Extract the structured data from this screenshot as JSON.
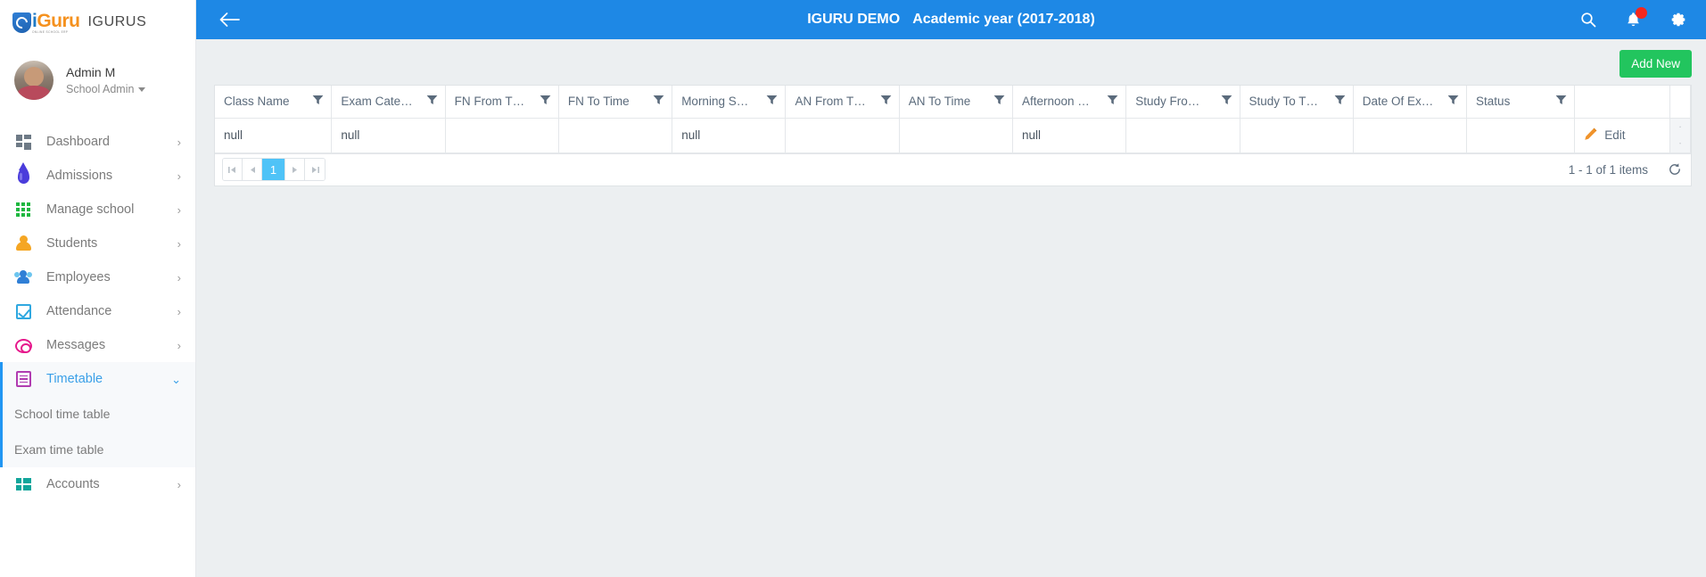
{
  "brand": {
    "logo_word_i": "i",
    "logo_word_rest": "Guru",
    "logo_tagline": "ONLINE SCHOOL ERP",
    "app_name": "IGURUS"
  },
  "profile": {
    "name": "Admin M",
    "role": "School Admin",
    "avatar_icon": "user-avatar",
    "caret_icon": "caret-down-icon"
  },
  "sidebar": {
    "items": [
      {
        "label": "Dashboard",
        "icon": "dashboard-icon",
        "arrow": "›",
        "active": false
      },
      {
        "label": "Admissions",
        "icon": "droplet-icon",
        "arrow": "›",
        "active": false
      },
      {
        "label": "Manage school",
        "icon": "grid-icon",
        "arrow": "›",
        "active": false
      },
      {
        "label": "Students",
        "icon": "user-icon",
        "arrow": "›",
        "active": false
      },
      {
        "label": "Employees",
        "icon": "group-icon",
        "arrow": "›",
        "active": false
      },
      {
        "label": "Attendance",
        "icon": "checkbox-icon",
        "arrow": "›",
        "active": false
      },
      {
        "label": "Messages",
        "icon": "chat-icon",
        "arrow": "›",
        "active": false
      },
      {
        "label": "Timetable",
        "icon": "list-icon",
        "arrow": "⌄",
        "active": true
      },
      {
        "label": "Accounts",
        "icon": "accounts-icon",
        "arrow": "›",
        "active": false
      }
    ],
    "submenu": [
      {
        "label": "School time table"
      },
      {
        "label": "Exam time table"
      }
    ]
  },
  "topbar": {
    "back_icon": "arrow-left-icon",
    "demo_label": "IGURU DEMO",
    "academic_year": "Academic year (2017-2018)",
    "search_icon": "search-icon",
    "notifications_icon": "bell-icon",
    "settings_icon": "gear-icon",
    "has_notification_dot": true,
    "background_color": "#1e88e5"
  },
  "toolbar": {
    "add_new_label": "Add New",
    "add_new_color": "#22c55e"
  },
  "grid": {
    "columns": [
      {
        "label": "Class Name",
        "filter_icon": "funnel-icon"
      },
      {
        "label": "Exam Cate…",
        "filter_icon": "funnel-icon"
      },
      {
        "label": "FN From T…",
        "filter_icon": "funnel-icon"
      },
      {
        "label": "FN To Time",
        "filter_icon": "funnel-icon"
      },
      {
        "label": "Morning S…",
        "filter_icon": "funnel-icon"
      },
      {
        "label": "AN From T…",
        "filter_icon": "funnel-icon"
      },
      {
        "label": "AN To Time",
        "filter_icon": "funnel-icon"
      },
      {
        "label": "Afternoon …",
        "filter_icon": "funnel-icon"
      },
      {
        "label": "Study Fro…",
        "filter_icon": "funnel-icon"
      },
      {
        "label": "Study To T…",
        "filter_icon": "funnel-icon"
      },
      {
        "label": "Date Of Ex…",
        "filter_icon": "funnel-icon"
      },
      {
        "label": "Status",
        "filter_icon": "funnel-icon"
      },
      {
        "label": "",
        "filter_icon": ""
      }
    ],
    "rows": [
      {
        "cells": [
          "null",
          "null",
          "",
          "",
          "null",
          "",
          "",
          "null",
          "",
          "",
          "",
          ""
        ],
        "action_label": "Edit",
        "action_icon": "pencil-icon"
      }
    ],
    "scroll_up_icon": "triangle-up-icon",
    "scroll_down_icon": "triangle-down-icon"
  },
  "pager": {
    "first_icon": "page-first-icon",
    "prev_icon": "page-prev-icon",
    "next_icon": "page-next-icon",
    "last_icon": "page-last-icon",
    "pages": [
      {
        "label": "1",
        "active": true
      }
    ],
    "items_info": "1 - 1 of 1 items",
    "refresh_icon": "refresh-icon"
  }
}
